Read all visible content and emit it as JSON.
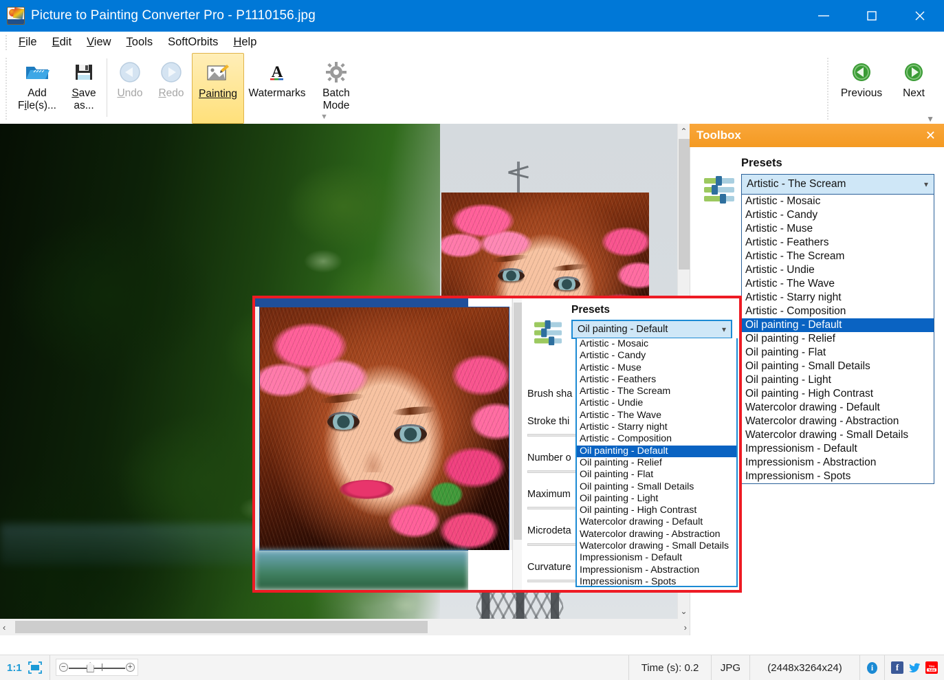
{
  "window": {
    "title": "Picture to Painting Converter Pro - P1110156.jpg",
    "app_icon": "picture-painting-icon",
    "minimize": "─",
    "maximize": "□",
    "close": "✕"
  },
  "menu": {
    "items": [
      {
        "label": "File",
        "accel": "F"
      },
      {
        "label": "Edit",
        "accel": "E"
      },
      {
        "label": "View",
        "accel": "V"
      },
      {
        "label": "Tools",
        "accel": "T"
      },
      {
        "label": "SoftOrbits",
        "accel": ""
      },
      {
        "label": "Help",
        "accel": "H"
      }
    ]
  },
  "toolbar": {
    "add_files": "Add\nFile(s)...",
    "add_files_line1": "Add",
    "add_files_line2": "File(s)...",
    "save_as_line1": "Save",
    "save_as_line2": "as...",
    "undo": "Undo",
    "redo": "Redo",
    "painting": "Painting",
    "watermarks": "Watermarks",
    "batch_line1": "Batch",
    "batch_line2": "Mode",
    "previous": "Previous",
    "next": "Next"
  },
  "toolbox": {
    "title": "Toolbox",
    "close": "✕",
    "presets_label": "Presets",
    "selected_preset": "Artistic - The Scream",
    "caret": "⌄",
    "options": [
      "Artistic - Mosaic",
      "Artistic - Candy",
      "Artistic - Muse",
      "Artistic - Feathers",
      "Artistic - The Scream",
      "Artistic - Undie",
      "Artistic - The Wave",
      "Artistic - Starry night",
      "Artistic - Composition",
      "Oil painting - Default",
      "Oil painting - Relief",
      "Oil painting - Flat",
      "Oil painting - Small Details",
      "Oil painting - Light",
      "Oil painting - High Contrast",
      "Watercolor drawing - Default",
      "Watercolor drawing - Abstraction",
      "Watercolor drawing - Small Details",
      "Impressionism - Default",
      "Impressionism - Abstraction",
      "Impressionism - Spots"
    ],
    "highlighted_option": "Oil painting - Default"
  },
  "callout": {
    "presets_label": "Presets",
    "selected_preset": "Oil painting - Default",
    "caret": "⌄",
    "highlighted_option": "Oil painting - Default",
    "options": [
      "Artistic - Mosaic",
      "Artistic - Candy",
      "Artistic - Muse",
      "Artistic - Feathers",
      "Artistic - The Scream",
      "Artistic - Undie",
      "Artistic - The Wave",
      "Artistic - Starry night",
      "Artistic - Composition",
      "Oil painting - Default",
      "Oil painting - Relief",
      "Oil painting - Flat",
      "Oil painting - Small Details",
      "Oil painting - Light",
      "Oil painting - High Contrast",
      "Watercolor drawing - Default",
      "Watercolor drawing - Abstraction",
      "Watercolor drawing - Small Details",
      "Impressionism - Default",
      "Impressionism - Abstraction",
      "Impressionism - Spots"
    ],
    "params": [
      "Brush sha",
      "Stroke thi",
      "Number o",
      "Maximum",
      "Microdeta",
      "Curvature"
    ]
  },
  "statusbar": {
    "zoom_ratio": "1:1",
    "fit_icon": "fit-to-window-icon",
    "zoom_out": "−",
    "zoom_in": "+",
    "time": "Time (s): 0.2",
    "format": "JPG",
    "dimensions": "(2448x3264x24)",
    "info_icon": "i",
    "facebook": "f",
    "twitter": "twitter-icon",
    "youtube": "You Tube"
  },
  "scroll": {
    "up": "⌃",
    "down": "⌄",
    "left": "‹",
    "right": "›"
  },
  "colors": {
    "titlebar": "#0078d7",
    "toolbox_header": "#f49a22",
    "selection": "#0a63c2",
    "combo_bg": "#cfe7f7",
    "callout_border": "#ee1b24",
    "accent_blue": "#1b8ad4"
  }
}
